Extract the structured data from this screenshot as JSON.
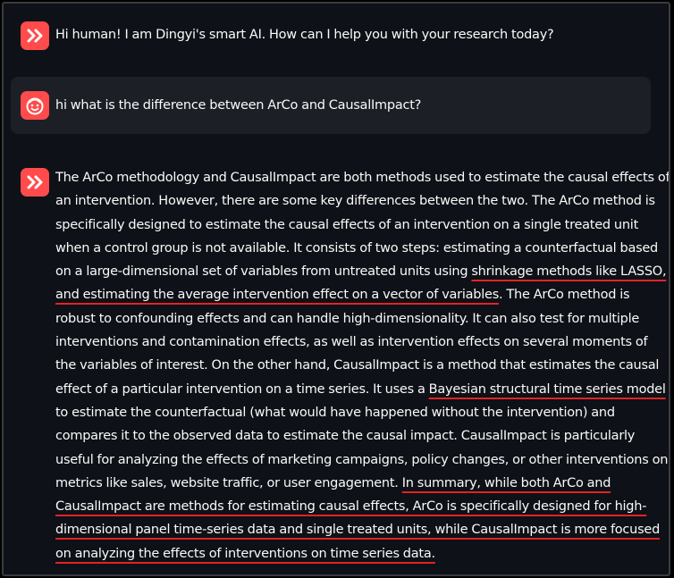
{
  "chat": {
    "messages": [
      {
        "role": "assistant",
        "avatar_icon": "double-chevron-icon",
        "text": "Hi human! I am Dingyi's smart AI. How can I help you with your research today?"
      },
      {
        "role": "user",
        "avatar_icon": "smiley-face-icon",
        "text": "hi what is the difference between ArCo and CausalImpact?"
      },
      {
        "role": "assistant",
        "avatar_icon": "double-chevron-icon",
        "lines": [
          [
            {
              "t": "The ArCo methodology and CausalImpact are both methods used to estimate the causal effects of"
            }
          ],
          [
            {
              "t": "an intervention. However, there are some key differences between the two. The ArCo method is"
            }
          ],
          [
            {
              "t": "specifically designed to estimate the causal effects of an intervention on a single treated unit"
            }
          ],
          [
            {
              "t": "when a control group is not available. It consists of two steps: estimating a counterfactual based"
            }
          ],
          [
            {
              "t": "on a large-dimensional set of variables from untreated units using "
            },
            {
              "t": "shrinkage methods like LASSO,",
              "u": true
            }
          ],
          [
            {
              "t": "and estimating the average intervention effect on a vector of variables",
              "u": true
            },
            {
              "t": ". The ArCo method is"
            }
          ],
          [
            {
              "t": "robust to confounding effects and can handle high-dimensionality. It can also test for multiple"
            }
          ],
          [
            {
              "t": "interventions and contamination effects, as well as intervention effects on several moments of"
            }
          ],
          [
            {
              "t": "the variables of interest. On the other hand, CausalImpact is a method that estimates the causal"
            }
          ],
          [
            {
              "t": "effect of a particular intervention on a time series. It uses a "
            },
            {
              "t": "Bayesian structural time series model",
              "u": true
            }
          ],
          [
            {
              "t": "to estimate the counterfactual (what would have happened without the intervention) and"
            }
          ],
          [
            {
              "t": "compares it to the observed data to estimate the causal impact. CausalImpact is particularly"
            }
          ],
          [
            {
              "t": "useful for analyzing the effects of marketing campaigns, policy changes, or other interventions on"
            }
          ],
          [
            {
              "t": "metrics like sales, website traffic, or user engagement. "
            },
            {
              "t": "In summary, while both ArCo and",
              "u": true
            }
          ],
          [
            {
              "t": "CausalImpact are methods for estimating causal effects, ArCo is specifically designed for high-",
              "u": true
            }
          ],
          [
            {
              "t": "dimensional panel time-series data and single treated units, while CausalImpact is more focused",
              "u": true
            }
          ],
          [
            {
              "t": "on analyzing the effects of interventions on time series data.",
              "u": true
            }
          ]
        ]
      }
    ]
  },
  "colors": {
    "background": "#0e1117",
    "user_bubble": "#1c1f26",
    "avatar_bg": "#ff4b4b",
    "text": "#fafafa",
    "underline": "#e02424"
  }
}
